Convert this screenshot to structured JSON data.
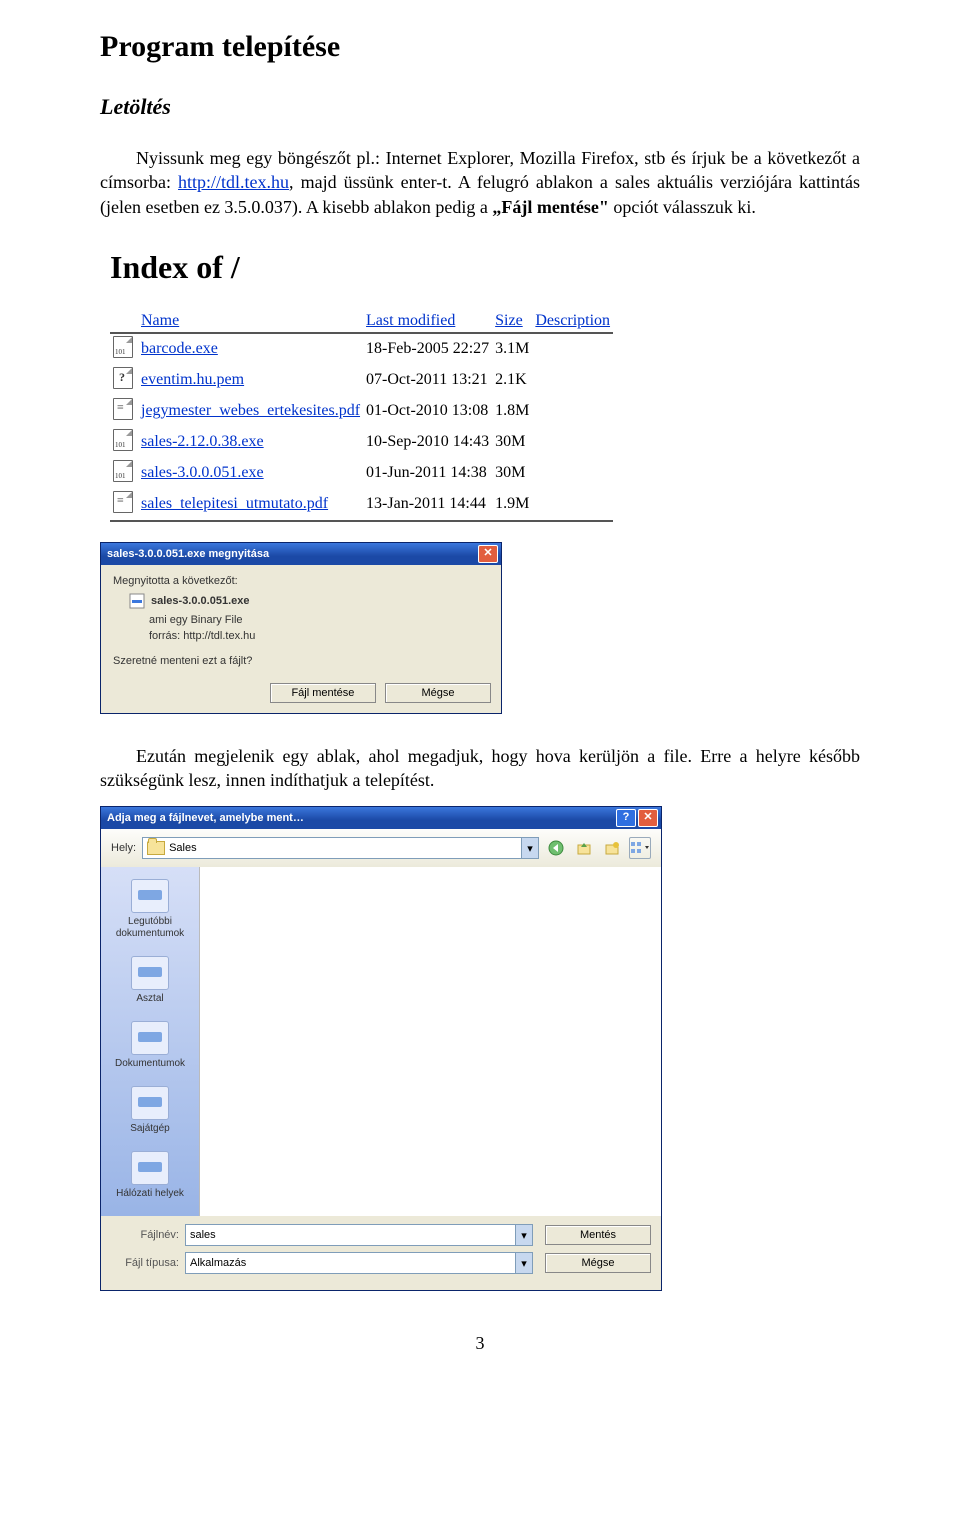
{
  "page": {
    "title": "Program telepítése",
    "subtitle": "Letöltés",
    "para1_a": "Nyissunk meg egy böngészőt pl.: Internet Explorer, Mozilla Firefox, stb és írjuk be a következőt a címsorba: ",
    "para1_link": "http://tdl.tex.hu",
    "para1_b": ", majd üssünk enter-t. A felugró ablakon a sales aktuális verziójára kattintás (jelen esetben ez 3.5.0.037). A kisebb ablakon pedig a ",
    "para1_bold": "„Fájl mentése\"",
    "para1_c": " opciót válasszuk ki.",
    "para2": "Ezután megjelenik egy ablak, ahol megadjuk, hogy hova kerüljön a file. Erre a helyre később szükségünk lesz, innen indíthatjuk a telepítést.",
    "number": "3"
  },
  "index": {
    "heading": "Index of /",
    "cols": {
      "name": "Name",
      "modified": "Last modified",
      "size": "Size",
      "desc": "Description"
    },
    "rows": [
      {
        "icon": "bin",
        "name": "barcode.exe",
        "modified": "18-Feb-2005 22:27",
        "size": "3.1M"
      },
      {
        "icon": "q",
        "name": "eventim.hu.pem",
        "modified": "07-Oct-2011 13:21",
        "size": "2.1K"
      },
      {
        "icon": "txt",
        "name": "jegymester_webes_ertekesites.pdf",
        "modified": "01-Oct-2010 13:08",
        "size": "1.8M"
      },
      {
        "icon": "bin",
        "name": "sales-2.12.0.38.exe",
        "modified": "10-Sep-2010 14:43",
        "size": "30M"
      },
      {
        "icon": "bin",
        "name": "sales-3.0.0.051.exe",
        "modified": "01-Jun-2011 14:38",
        "size": "30M"
      },
      {
        "icon": "txt",
        "name": "sales_telepitesi_utmutato.pdf",
        "modified": "13-Jan-2011 14:44",
        "size": "1.9M"
      }
    ]
  },
  "dl": {
    "title": "sales-3.0.0.051.exe megnyitása",
    "line1": "Megnyitotta a következőt:",
    "filename": "sales-3.0.0.051.exe",
    "line2a": "ami egy Binary File",
    "line2b": "forrás: http://tdl.tex.hu",
    "line3": "Szeretné menteni ezt a fájlt?",
    "save": "Fájl mentése",
    "cancel": "Mégse"
  },
  "saveas": {
    "title": "Adja meg a fájlnevet, amelybe ment…",
    "loc_label": "Hely:",
    "loc_value": "Sales",
    "places": [
      "Legutóbbi dokumentumok",
      "Asztal",
      "Dokumentumok",
      "Sajátgép",
      "Hálózati helyek"
    ],
    "fname_label": "Fájlnév:",
    "fname_value": "sales",
    "ftype_label": "Fájl típusa:",
    "ftype_value": "Alkalmazás",
    "btn_save": "Mentés",
    "btn_cancel": "Mégse"
  }
}
